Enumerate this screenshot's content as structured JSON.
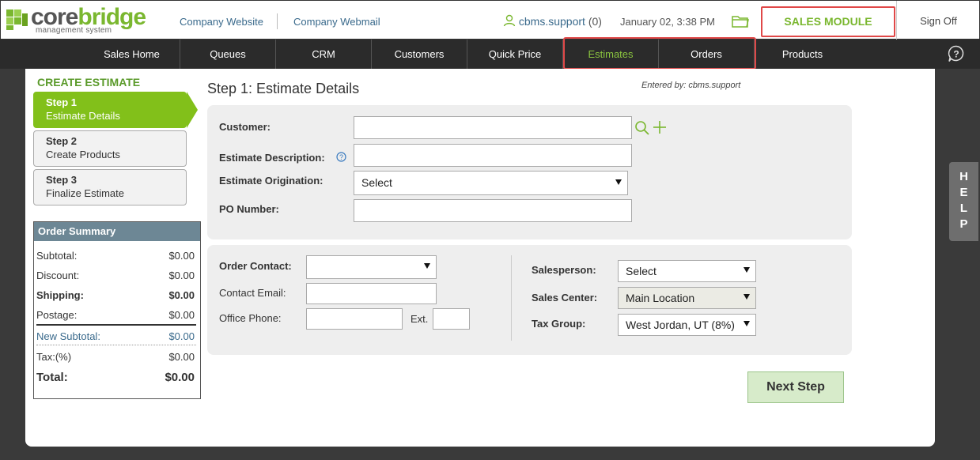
{
  "brand": {
    "name_gray": "core",
    "name_green": "bridge",
    "tagline": "management system"
  },
  "top_links": {
    "website": "Company Website",
    "webmail": "Company Webmail"
  },
  "user": {
    "name": "cbms.support",
    "count": "(0)"
  },
  "datetime": "January 02, 3:38 PM",
  "module_label": "SALES MODULE",
  "signoff_label": "Sign Off",
  "nav": {
    "items": [
      "Sales Home",
      "Queues",
      "CRM",
      "Customers",
      "Quick Price",
      "Estimates",
      "Orders",
      "Products"
    ],
    "active": "Estimates"
  },
  "sidebar": {
    "title": "CREATE ESTIMATE",
    "steps": [
      {
        "num": "Step 1",
        "desc": "Estimate Details"
      },
      {
        "num": "Step 2",
        "desc": "Create Products"
      },
      {
        "num": "Step 3",
        "desc": "Finalize Estimate"
      }
    ]
  },
  "summary": {
    "title": "Order Summary",
    "subtotal": {
      "label": "Subtotal:",
      "value": "$0.00"
    },
    "discount": {
      "label": "Discount:",
      "value": "$0.00"
    },
    "shipping": {
      "label": "Shipping:",
      "value": "$0.00"
    },
    "postage": {
      "label": "Postage:",
      "value": "$0.00"
    },
    "new_subtotal": {
      "label": "New Subtotal:",
      "value": "$0.00"
    },
    "tax": {
      "label": "Tax:(%)",
      "value": "$0.00"
    },
    "total": {
      "label": "Total:",
      "value": "$0.00"
    }
  },
  "form": {
    "step_title": "Step 1: Estimate Details",
    "entered_by": "Entered by: cbms.support",
    "customer_label": "Customer:",
    "description_label": "Estimate Description:",
    "origination_label": "Estimate Origination:",
    "origination_value": "Select",
    "po_label": "PO Number:",
    "order_contact_label": "Order Contact:",
    "contact_email_label": "Contact Email:",
    "office_phone_label": "Office Phone:",
    "ext_label": "Ext.",
    "salesperson_label": "Salesperson:",
    "salesperson_value": "Select",
    "sales_center_label": "Sales Center:",
    "sales_center_value": "Main Location",
    "tax_group_label": "Tax Group:",
    "tax_group_value": "West Jordan, UT (8%)"
  },
  "next_step_label": "Next Step",
  "help_tab": [
    "H",
    "E",
    "L",
    "P"
  ],
  "colors": {
    "accent": "#82c01a",
    "highlight": "#e04848",
    "nav_bg": "#2b2b2b",
    "link": "#3a6a8c"
  },
  "icons": [
    "logo-mark-icon",
    "user-icon",
    "folder-icon",
    "help-bubble-icon",
    "search-icon",
    "plus-icon",
    "info-icon",
    "chevron-down-icon"
  ]
}
